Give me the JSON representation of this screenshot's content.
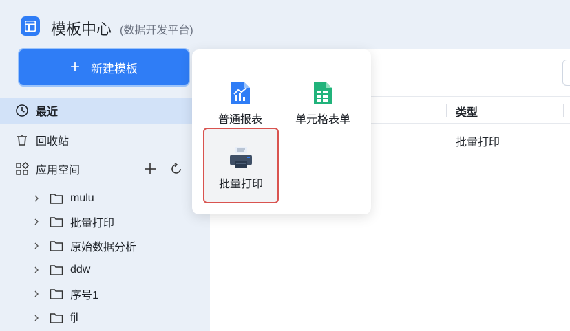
{
  "header": {
    "title": "模板中心",
    "subtitle": "(数据开发平台)"
  },
  "sidebar": {
    "new_button_label": "新建模板",
    "nav": [
      {
        "label": "最近",
        "icon": "clock-icon",
        "active": true
      },
      {
        "label": "回收站",
        "icon": "trash-icon",
        "active": false
      },
      {
        "label": "应用空间",
        "icon": "apps-icon",
        "active": false
      }
    ],
    "tree": [
      {
        "label": "mulu"
      },
      {
        "label": "批量打印"
      },
      {
        "label": "原始数据分析"
      },
      {
        "label": "ddw"
      },
      {
        "label": "序号1"
      },
      {
        "label": "fjl"
      }
    ]
  },
  "main": {
    "column_type": "类型",
    "rows": [
      {
        "type": "批量打印"
      }
    ]
  },
  "popup": {
    "tiles": [
      {
        "label": "普通报表",
        "icon": "report-chart-icon"
      },
      {
        "label": "单元格表单",
        "icon": "spreadsheet-icon"
      },
      {
        "label": "批量打印",
        "icon": "printer-icon",
        "selected": true
      }
    ]
  },
  "colors": {
    "accent": "#2f7df6",
    "sidebar_bg": "#eaf0f8",
    "active_bg": "#d2e2f8",
    "selection_border": "#d9534f"
  }
}
